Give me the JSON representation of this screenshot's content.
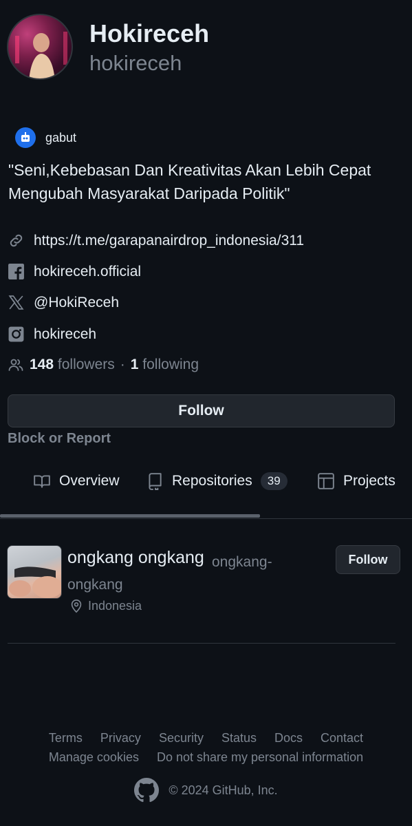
{
  "profile": {
    "name": "Hokireceh",
    "login": "hokireceh",
    "status_text": "gabut",
    "bio": "\"Seni,Kebebasan Dan Kreativitas Akan Lebih Cepat Mengubah Masyarakat Daripada Politik\"",
    "website": "https://t.me/garapanairdrop_indonesia/311",
    "facebook": "hokireceh.official",
    "x_handle": "@HokiReceh",
    "instagram": "hokireceh",
    "followers_count": "148",
    "followers_label": "followers",
    "separator": "·",
    "following_count": "1",
    "following_label": "following",
    "follow_label": "Follow",
    "block_label": "Block or Report"
  },
  "tabs": [
    {
      "label": "Overview",
      "icon": "book-icon"
    },
    {
      "label": "Repositories",
      "icon": "repo-icon",
      "counter": "39"
    },
    {
      "label": "Projects",
      "icon": "table-icon"
    }
  ],
  "card": {
    "name": "ongkang ongkang",
    "login": "ongkang-ongkang",
    "location": "Indonesia",
    "follow_label": "Follow"
  },
  "footer": {
    "links_row1": [
      "Terms",
      "Privacy",
      "Security",
      "Status",
      "Docs",
      "Contact"
    ],
    "links_row2": [
      "Manage cookies",
      "Do not share my personal information"
    ],
    "copyright": "© 2024 GitHub, Inc."
  },
  "colors": {
    "background": "#0d1117",
    "text_primary": "#e6edf3",
    "text_muted": "#7d8590",
    "button_bg": "#21262d",
    "border": "#30363d",
    "status_emoji_bg": "#1f6feb"
  }
}
